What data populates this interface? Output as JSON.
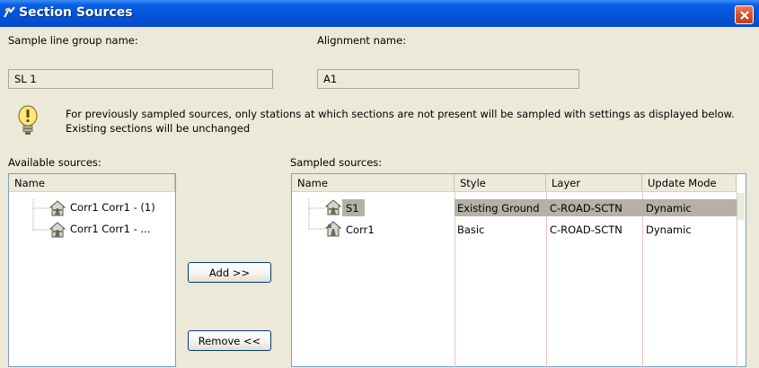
{
  "window": {
    "title": "Section Sources"
  },
  "sample_line_group": {
    "label": "Sample line group name:",
    "value": "SL 1"
  },
  "alignment": {
    "label": "Alignment name:",
    "value": "A1"
  },
  "info": {
    "message": "For previously sampled sources, only stations at which sections are not present will be sampled with settings as displayed below. Existing sections will be unchanged"
  },
  "available": {
    "label": "Available sources:",
    "header": "Name",
    "items": [
      {
        "name": "Corr1 Corr1 - (1)"
      },
      {
        "name": "Corr1 Corr1 - ..."
      }
    ]
  },
  "buttons": {
    "add": "Add >>",
    "remove": "Remove <<"
  },
  "sampled": {
    "label": "Sampled sources:",
    "columns": [
      "Name",
      "Style",
      "Layer",
      "Update Mode"
    ],
    "rows": [
      {
        "name": "S1",
        "style": "Existing Ground",
        "layer": "C-ROAD-SCTN",
        "update_mode": "Dynamic",
        "selected": true
      },
      {
        "name": "Corr1",
        "style": "Basic",
        "layer": "C-ROAD-SCTN",
        "update_mode": "Dynamic",
        "selected": false
      }
    ]
  },
  "colors": {
    "titlebar": "#0553d8",
    "dialog_bg": "#ece9d8",
    "selected_row": "#b5b1a5",
    "grid_line": "#e8c3c3",
    "close_button": "#d8502a"
  },
  "icons": {
    "title": "civil3d-app-icon",
    "close": "close-icon",
    "info": "lightbulb-info-icon",
    "source": "corridor-surface-icon"
  }
}
